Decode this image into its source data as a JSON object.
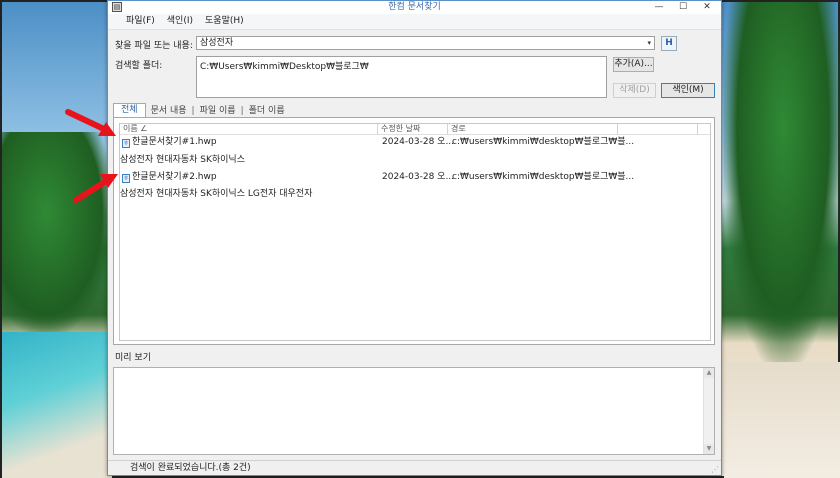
{
  "window": {
    "title": "한컴 문서찾기",
    "app_icon": "document-icon",
    "controls": [
      "—",
      "☐",
      "✕"
    ]
  },
  "menu": [
    {
      "label": "파일(F)"
    },
    {
      "label": "색인(I)"
    },
    {
      "label": "도움말(H)"
    }
  ],
  "search": {
    "label": "찾을 파일 또는 내용:",
    "value": "삼성전자",
    "dropdown_glyph": "▾",
    "button_glyph": "H",
    "button_icon": "search-icon"
  },
  "folder": {
    "label": "검색할 폴더:",
    "value": "C:₩Users₩kimmi₩Desktop₩블로그₩"
  },
  "buttons": {
    "add": "추가(A)...",
    "delete": "삭제(D)",
    "index": "색인(M)"
  },
  "tabs": [
    {
      "label": "전체"
    },
    {
      "label": "문서 내용"
    },
    {
      "label": "파일 이름"
    },
    {
      "label": "폴더 이름"
    }
  ],
  "tab_separator": "|",
  "columns": {
    "name": "이름  ∠",
    "modified": "수정한 날짜",
    "path": "경로"
  },
  "results": [
    {
      "name": "한글문서찾기#1.hwp",
      "modified": "2024-03-28 오...",
      "path": "c:₩users₩kimmi₩desktop₩블로그₩블...",
      "snippet": "삼성전자 현대자동차 SK하이닉스"
    },
    {
      "name": "한글문서찾기#2.hwp",
      "modified": "2024-03-28 오...",
      "path": "c:₩users₩kimmi₩desktop₩블로그₩블...",
      "snippet": "삼성전자 현대자동차 SK하이닉스  LG전자 대우전자"
    }
  ],
  "preview": {
    "label": "미리 보기"
  },
  "status": {
    "text": "검색이 완료되었습니다.(총 2건)"
  },
  "colors": {
    "title_text": "#3a6aa8",
    "arrow": "#e8141c",
    "window_border": "#5a8fc7"
  }
}
